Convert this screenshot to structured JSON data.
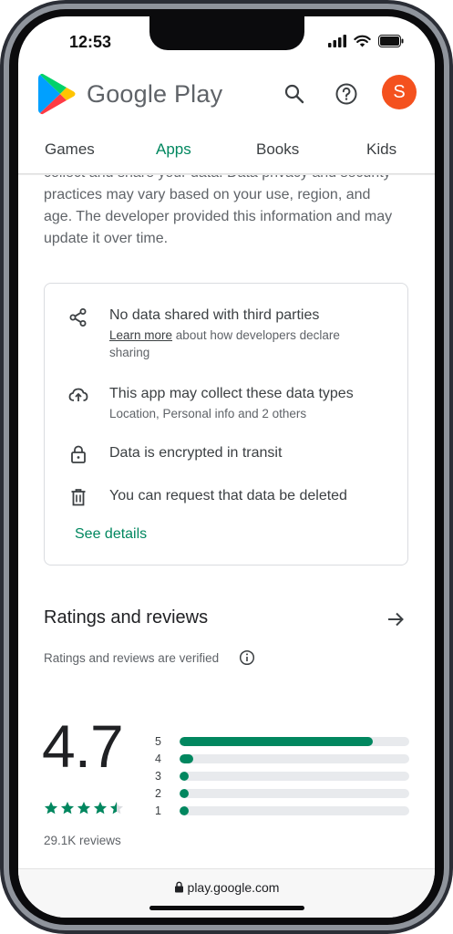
{
  "status_bar": {
    "time": "12:53"
  },
  "header": {
    "brand": "Google Play",
    "avatar_letter": "S"
  },
  "tabs": [
    {
      "label": "Games"
    },
    {
      "label": "Apps"
    },
    {
      "label": "Books"
    },
    {
      "label": "Kids"
    }
  ],
  "active_tab": "Apps",
  "intro_text": "collect and share your data. Data privacy and security practices may vary based on your use, region, and age. The developer provided this information and may update it over time.",
  "data_safety": {
    "items": [
      {
        "icon": "share-icon",
        "title": "No data shared with third parties",
        "link": "Learn more",
        "subtitle": " about how developers declare sharing"
      },
      {
        "icon": "cloud-upload-icon",
        "title": "This app may collect these data types",
        "subtitle": "Location, Personal info and 2 others"
      },
      {
        "icon": "lock-icon",
        "title": "Data is encrypted in transit"
      },
      {
        "icon": "trash-icon",
        "title": "You can request that data be deleted"
      }
    ],
    "see_details": "See details"
  },
  "ratings": {
    "title": "Ratings and reviews",
    "verified_text": "Ratings and reviews are verified",
    "average": "4.7",
    "stars_filled": 4.5,
    "review_count": "29.1K reviews",
    "distribution": [
      {
        "label": "5",
        "fraction": 0.84
      },
      {
        "label": "4",
        "fraction": 0.06
      },
      {
        "label": "3",
        "fraction": 0.03
      },
      {
        "label": "2",
        "fraction": 0.01
      },
      {
        "label": "1",
        "fraction": 0.04
      }
    ]
  },
  "url_bar": {
    "url": "play.google.com"
  },
  "colors": {
    "accent": "#01875f",
    "avatar": "#f4511e",
    "text_primary": "#202124",
    "text_secondary": "#5f6368"
  }
}
